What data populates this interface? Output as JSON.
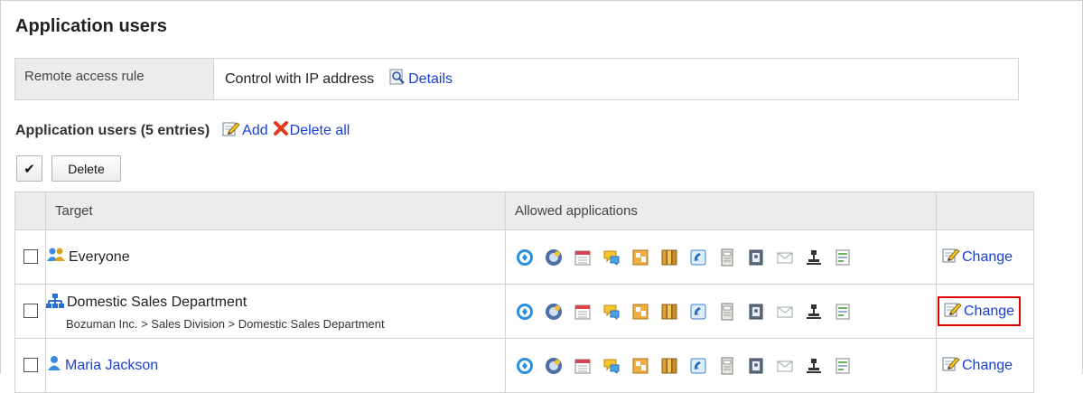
{
  "section": {
    "title": "Application users"
  },
  "remote_access": {
    "label": "Remote access rule",
    "value": "Control with IP address",
    "details_link": "Details"
  },
  "list": {
    "title": "Application users (5 entries)",
    "add_link": "Add",
    "delete_all_link": "Delete all"
  },
  "toolbar": {
    "check_label": "✔",
    "delete_label": "Delete"
  },
  "table": {
    "headers": {
      "target": "Target",
      "allowed": "Allowed applications"
    },
    "change_label": "Change",
    "rows": [
      {
        "type": "role",
        "name": "Everyone",
        "is_link": false,
        "path": ""
      },
      {
        "type": "organization",
        "name": "Domestic Sales Department",
        "is_link": false,
        "path": "Bozuman Inc. > Sales Division > Domestic Sales Department"
      },
      {
        "type": "user",
        "name": "Maria Jackson",
        "is_link": true,
        "path": ""
      }
    ],
    "apps": [
      "portal-icon",
      "space-icon",
      "scheduler-icon",
      "message-icon",
      "bulletin-board-icon",
      "cabinet-icon",
      "phone-messages-icon",
      "timecard-icon",
      "address-book-icon",
      "email-icon",
      "workflow-icon",
      "report-icon"
    ]
  },
  "colors": {
    "link": "#1a3fd6",
    "highlight": "#e00000",
    "header_bg": "#ececec"
  }
}
